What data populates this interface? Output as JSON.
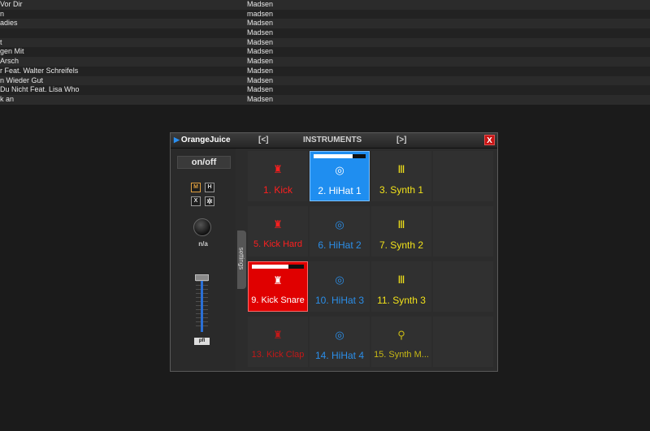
{
  "tracklist": [
    {
      "title": "Vor Dir",
      "artist": "Madsen"
    },
    {
      "title": "n",
      "artist": "madsen"
    },
    {
      "title": "adies",
      "artist": "Madsen"
    },
    {
      "title": "",
      "artist": "Madsen"
    },
    {
      "title": "t",
      "artist": "Madsen"
    },
    {
      "title": "gen Mit",
      "artist": "Madsen"
    },
    {
      "title": "Arsch",
      "artist": "Madsen"
    },
    {
      "title": "r Feat. Walter Schreifels",
      "artist": "Madsen"
    },
    {
      "title": "n Wieder Gut",
      "artist": "Madsen"
    },
    {
      "title": "Du Nicht Feat. Lisa Who",
      "artist": "Madsen"
    },
    {
      "title": "k an",
      "artist": "Madsen"
    }
  ],
  "panel": {
    "brand": "OrangeJuice",
    "prev": "[<]",
    "title": "INSTRUMENTS",
    "next": "[>]",
    "close": "X"
  },
  "controls": {
    "onoff": "on/off",
    "m": "M",
    "h": "H",
    "x": "X",
    "gear": "✲",
    "knob_label": "n/a",
    "pfl": "pfl",
    "settings": "settings"
  },
  "pads": [
    {
      "label": "1. Kick",
      "icon": "♜",
      "color": "red",
      "state": "normal"
    },
    {
      "label": "2. HiHat 1",
      "icon": "◎",
      "color": "blue",
      "state": "active",
      "level": 0.75
    },
    {
      "label": "3. Synth 1",
      "icon": "Ⅲ",
      "color": "yellow",
      "state": "normal"
    },
    {
      "label": "5. Kick Hard",
      "icon": "♜",
      "color": "red",
      "state": "normal"
    },
    {
      "label": "6. HiHat 2",
      "icon": "◎",
      "color": "blue",
      "state": "normal"
    },
    {
      "label": "7. Synth 2",
      "icon": "Ⅲ",
      "color": "yellow",
      "state": "normal"
    },
    {
      "label": "9. Kick Snare",
      "icon": "♜",
      "color": "red",
      "state": "active",
      "level": 0.7
    },
    {
      "label": "10. HiHat 3",
      "icon": "◎",
      "color": "blue",
      "state": "normal"
    },
    {
      "label": "11. Synth 3",
      "icon": "Ⅲ",
      "color": "yellow",
      "state": "normal"
    },
    {
      "label": "13. Kick Clap",
      "icon": "♜",
      "color": "red",
      "state": "dim"
    },
    {
      "label": "14. HiHat 4",
      "icon": "◎",
      "color": "blue",
      "state": "normal"
    },
    {
      "label": "15. Synth M...",
      "icon": "⚲",
      "color": "yellow",
      "state": "dim"
    }
  ]
}
